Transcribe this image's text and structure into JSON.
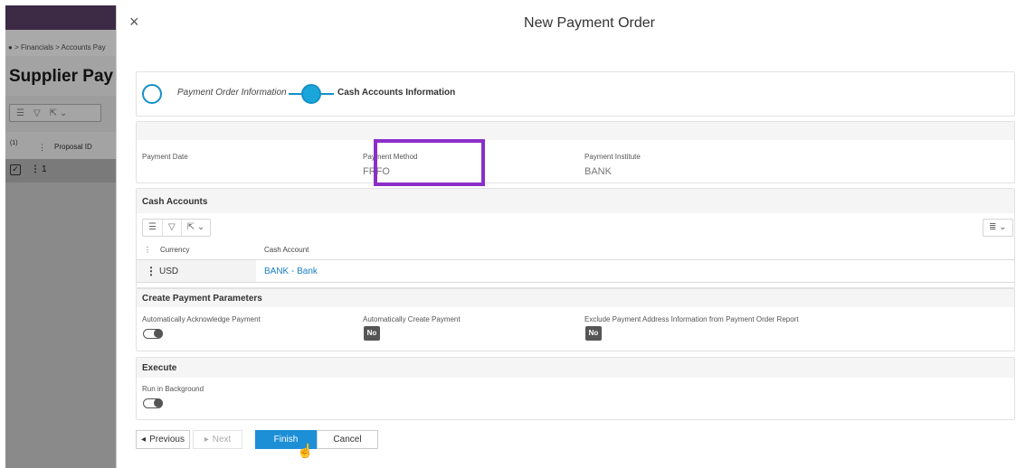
{
  "background_page": {
    "breadcrumb": "> Financials > Accounts Pay",
    "title": "Supplier Pay",
    "toolbar_icons": [
      "list-icon",
      "filter-icon",
      "export-icon"
    ],
    "table": {
      "count": "(1)",
      "header_proposal_id": "Proposal ID",
      "row_value": "1"
    }
  },
  "dialog": {
    "title": "New Payment Order",
    "close_glyph": "×",
    "stepper": {
      "step1_label": "Payment Order Information",
      "step2_label": "Cash Accounts Information"
    },
    "info": {
      "payment_date_label": "Payment Date",
      "payment_method_label": "Payment Method",
      "payment_method_value": "FRFO",
      "payment_institute_label": "Payment Institute",
      "payment_institute_value": "BANK",
      "highlight_color": "#8b2fc9"
    },
    "cash_accounts": {
      "title": "Cash Accounts",
      "columns": {
        "currency": "Currency",
        "cash_account": "Cash Account"
      },
      "rows": [
        {
          "currency": "USD",
          "cash_account": "BANK - Bank"
        }
      ]
    },
    "params": {
      "title": "Create Payment Parameters",
      "auto_ack_label": "Automatically Acknowledge Payment",
      "auto_create_label": "Automatically Create Payment",
      "auto_create_value": "No",
      "exclude_label": "Exclude Payment Address Information from Payment Order Report",
      "exclude_value": "No"
    },
    "execute": {
      "title": "Execute",
      "run_bg_label": "Run in Background"
    },
    "footer": {
      "previous": "Previous",
      "next": "Next",
      "finish": "Finish",
      "cancel": "Cancel"
    },
    "accent_color": "#1c8fd6"
  }
}
